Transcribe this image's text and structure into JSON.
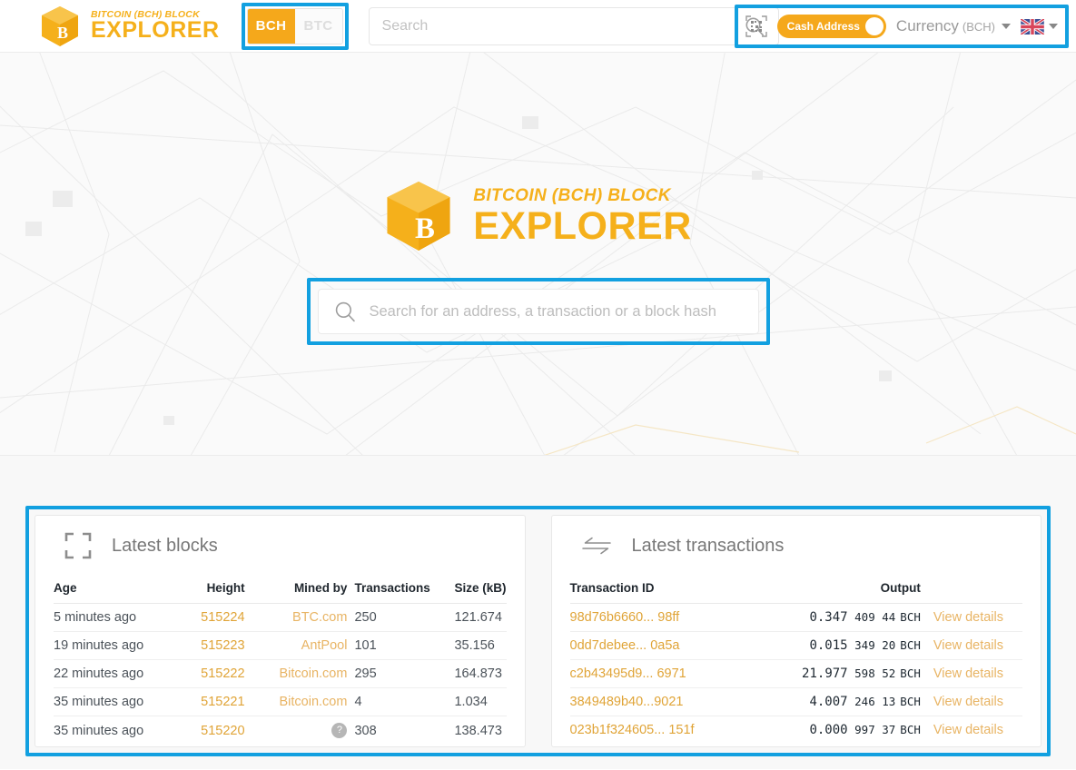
{
  "header": {
    "brand": {
      "sub": "BITCOIN (BCH) BLOCK",
      "main": "EXPLORER",
      "icon": "bitcoin-cube-logo"
    },
    "coin_toggle": {
      "active": "BCH",
      "inactive": "BTC"
    },
    "search": {
      "value": "",
      "placeholder": "Search",
      "icon": "search-icon"
    },
    "qr_icon": "qr-code-scan-icon",
    "cash_address": {
      "label": "Cash Address",
      "state": "on"
    },
    "currency": {
      "label": "Currency",
      "code": "(BCH)",
      "caret": "chevron-down-icon"
    },
    "language": {
      "flag": "uk-flag-icon",
      "caret": "chevron-down-icon"
    }
  },
  "hero": {
    "brand": {
      "sub": "BITCOIN (BCH) BLOCK",
      "main": "EXPLORER",
      "icon": "bitcoin-cube-logo"
    },
    "search": {
      "value": "",
      "placeholder": "Search for an address, a transaction or a block hash",
      "icon": "search-icon"
    }
  },
  "latest_blocks": {
    "title": "Latest blocks",
    "icon": "block-frame-icon",
    "columns": [
      "Age",
      "Height",
      "Mined by",
      "Transactions",
      "Size (kB)"
    ],
    "rows": [
      {
        "age": "5 minutes ago",
        "height": "515224",
        "mined_by": "BTC.com",
        "mined_by_icon": "",
        "transactions": "250",
        "size": "121.674"
      },
      {
        "age": "19 minutes ago",
        "height": "515223",
        "mined_by": "AntPool",
        "mined_by_icon": "",
        "transactions": "101",
        "size": "35.156"
      },
      {
        "age": "22 minutes ago",
        "height": "515222",
        "mined_by": "Bitcoin.com",
        "mined_by_icon": "",
        "transactions": "295",
        "size": "164.873"
      },
      {
        "age": "35 minutes ago",
        "height": "515221",
        "mined_by": "Bitcoin.com",
        "mined_by_icon": "",
        "transactions": "4",
        "size": "1.034"
      },
      {
        "age": "35 minutes ago",
        "height": "515220",
        "mined_by": "",
        "mined_by_icon": "unknown-miner-icon",
        "transactions": "308",
        "size": "138.473"
      }
    ]
  },
  "latest_transactions": {
    "title": "Latest transactions",
    "icon": "transfer-arrows-icon",
    "columns": [
      "Transaction ID",
      "Output"
    ],
    "view_details_label": "View details",
    "rows": [
      {
        "txid": "98d76b6660... 98ff",
        "amount_int": "0.347",
        "amount_frac": "409 44",
        "unit": "BCH"
      },
      {
        "txid": "0dd7debee... 0a5a",
        "amount_int": "0.015",
        "amount_frac": "349 20",
        "unit": "BCH"
      },
      {
        "txid": "c2b43495d9... 6971",
        "amount_int": "21.977",
        "amount_frac": "598 52",
        "unit": "BCH"
      },
      {
        "txid": "3849489b40...9021",
        "amount_int": "4.007",
        "amount_frac": "246 13",
        "unit": "BCH"
      },
      {
        "txid": "023b1f324605... 151f",
        "amount_int": "0.000",
        "amount_frac": "997 37",
        "unit": "BCH"
      }
    ]
  },
  "colors": {
    "brand_amber": "#F5B01B",
    "link_amber": "#E0A437",
    "annotation_blue": "#12A0E0",
    "text_dark": "#20272e",
    "text_muted": "#777777"
  }
}
